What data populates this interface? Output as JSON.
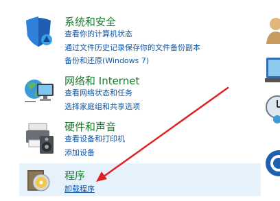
{
  "categories": [
    {
      "title": "系统和安全",
      "links": [
        "查看你的计算机状态",
        "通过文件历史记录保存你的文件备份副本",
        "备份和还原(Windows 7)"
      ]
    },
    {
      "title": "网络和 Internet",
      "links": [
        "查看网络状态和任务",
        "选择家庭组和共享选项"
      ]
    },
    {
      "title": "硬件和声音",
      "links": [
        "查看设备和打印机",
        "添加设备"
      ]
    },
    {
      "title": "程序",
      "links": [
        "卸载程序"
      ]
    }
  ],
  "colors": {
    "title": "#1a7a2e",
    "link": "#0d56a8",
    "highlight": "#e5f1fb",
    "arrow": "#e02020"
  },
  "icons": [
    "shield-icon",
    "network-globe-icon",
    "printer-speaker-icon",
    "programs-disc-icon",
    "user-icon",
    "monitor-icon",
    "clock-globe-icon",
    "ease-of-access-icon"
  ],
  "annotation": "red-arrow-pointing-to-uninstall-link"
}
